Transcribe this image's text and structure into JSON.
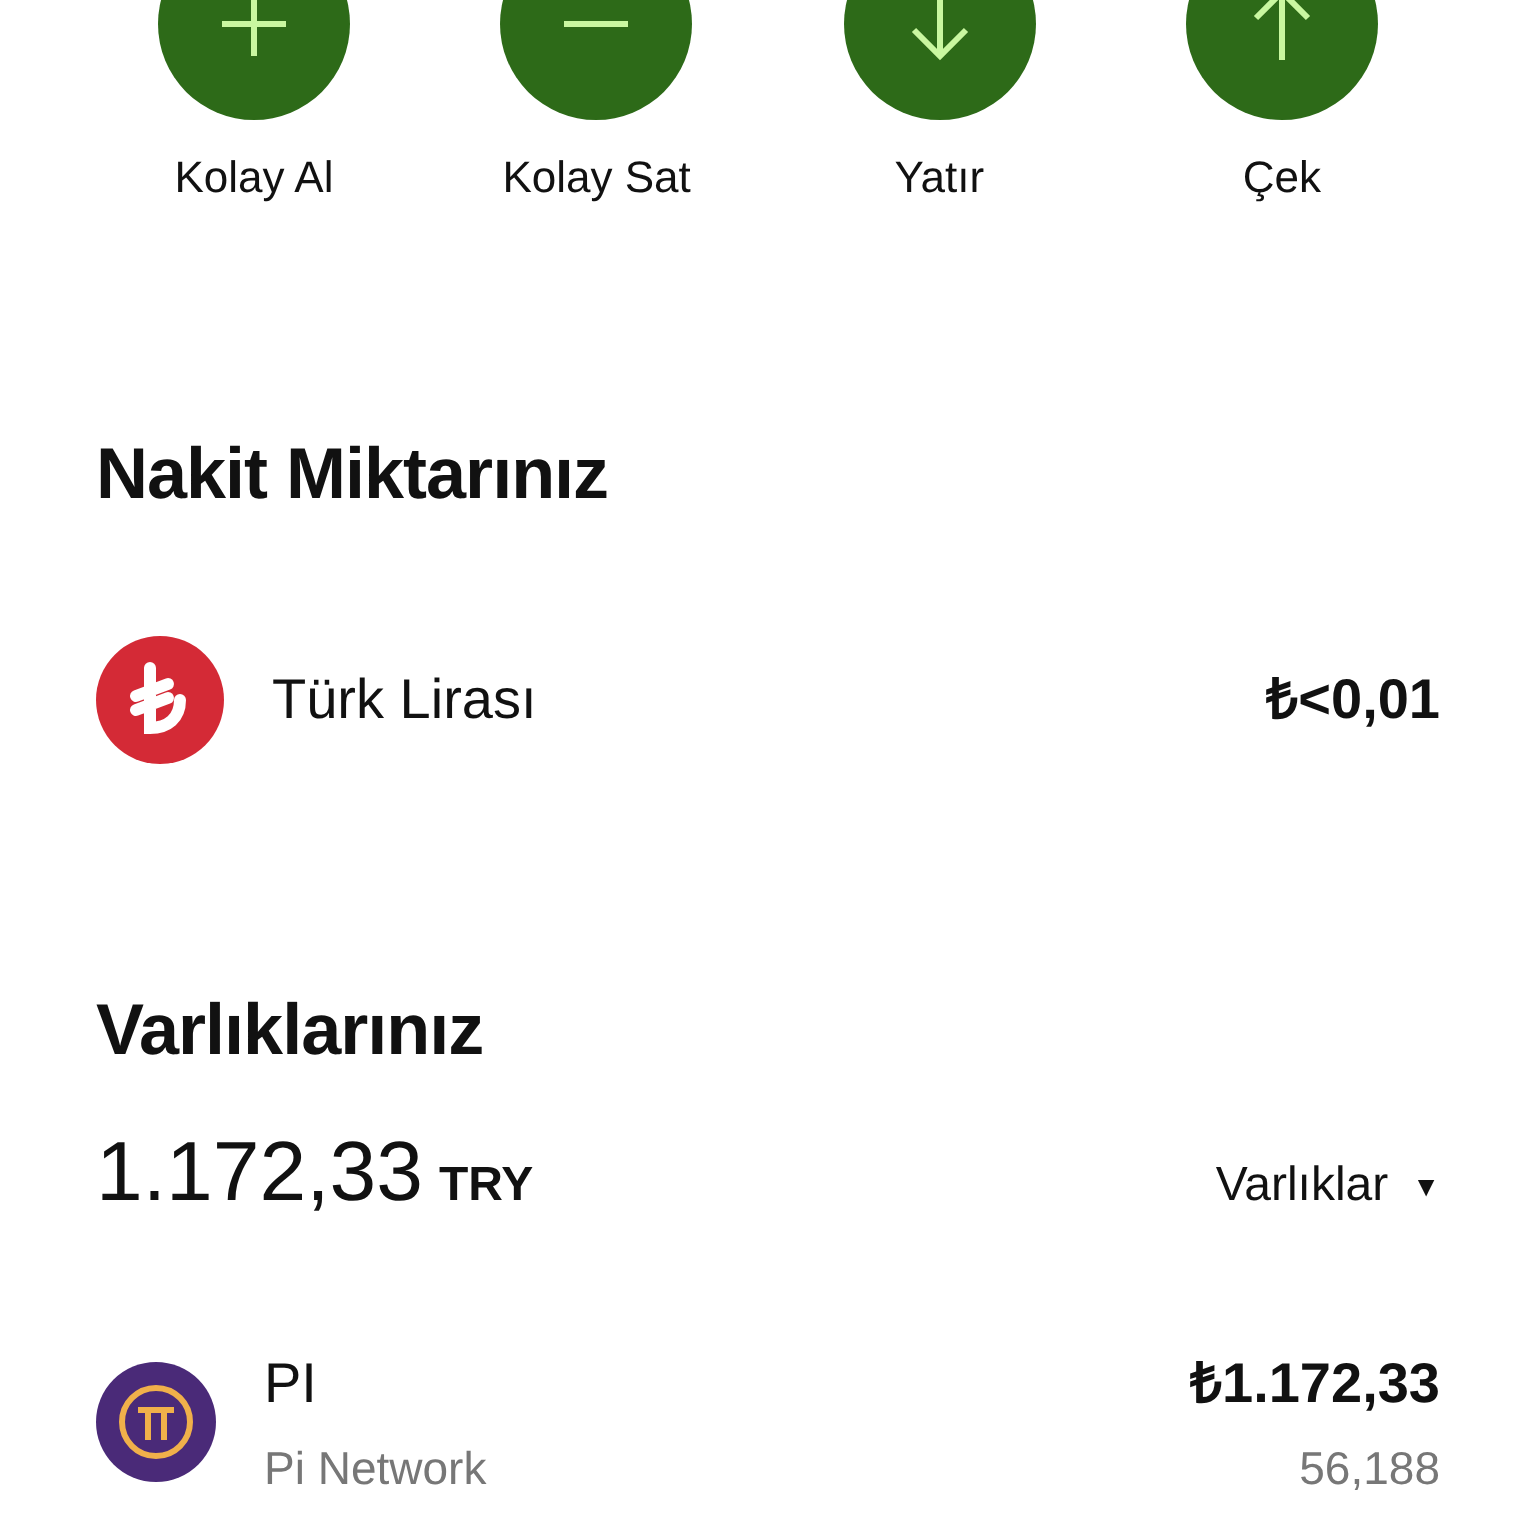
{
  "actions": [
    {
      "kind": "plus",
      "label": "Kolay Al"
    },
    {
      "kind": "minus",
      "label": "Kolay Sat"
    },
    {
      "kind": "down",
      "label": "Yatır"
    },
    {
      "kind": "up",
      "label": "Çek"
    }
  ],
  "cash": {
    "title": "Nakit Miktarınız",
    "items": [
      {
        "kind": "lira",
        "name": "Türk Lirası",
        "amount": "₺<0,01"
      }
    ]
  },
  "assets": {
    "title": "Varlıklarınız",
    "total": "1.172,33",
    "currency": "TRY",
    "filter": "Varlıklar",
    "caret": "▼",
    "items": [
      {
        "kind": "pi",
        "symbol": "PI",
        "name": "Pi Network",
        "value": "₺1.172,33",
        "quantity": "56,188"
      }
    ]
  }
}
